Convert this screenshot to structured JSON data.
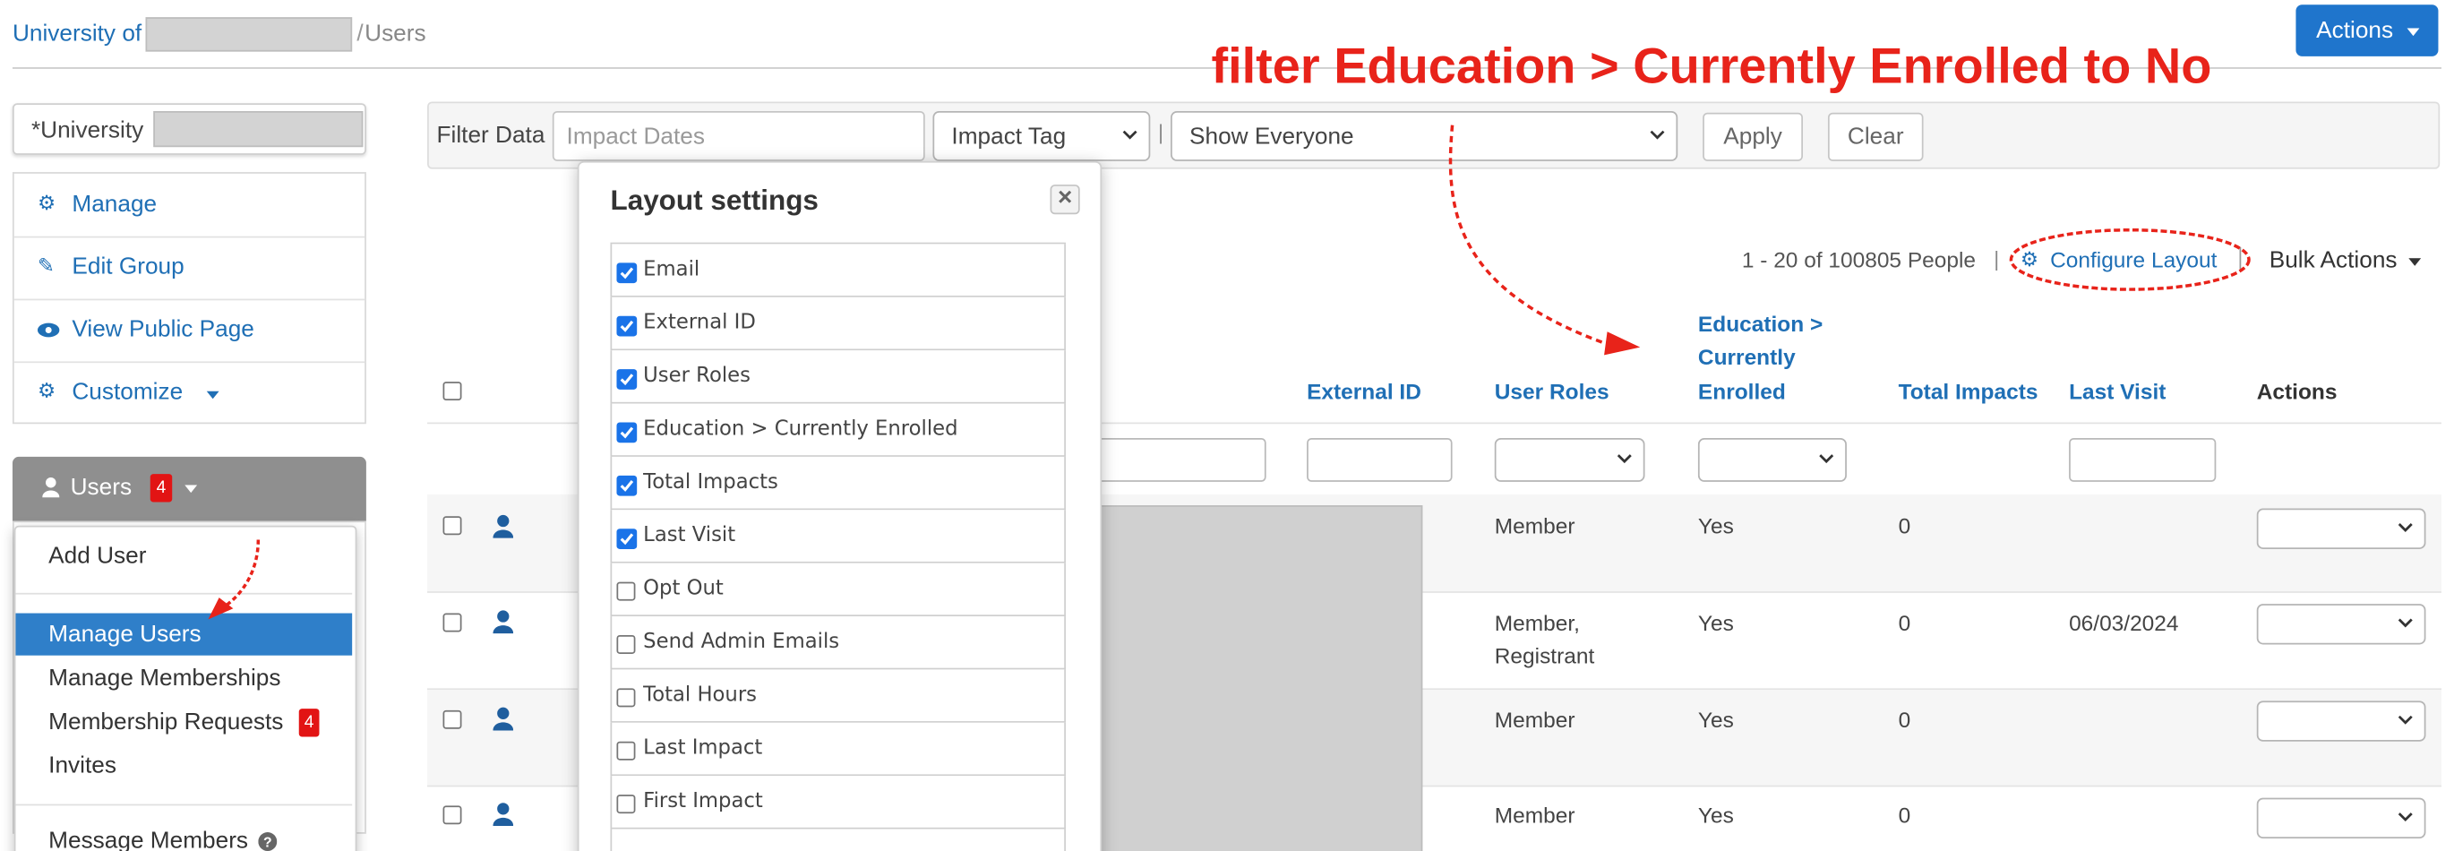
{
  "breadcrumb": {
    "root": "University of",
    "current": "Users",
    "separator": "/"
  },
  "header": {
    "actions_label": "Actions"
  },
  "annotation": {
    "text": "filter Education > Currently Enrolled to No"
  },
  "sidebar": {
    "group_name": "*University",
    "links": [
      {
        "label": "Manage",
        "icon": "gears-icon"
      },
      {
        "label": "Edit Group",
        "icon": "pencil-icon"
      },
      {
        "label": "View Public Page",
        "icon": "eye-icon"
      },
      {
        "label": "Customize",
        "icon": "gears-icon"
      }
    ],
    "users_button": {
      "label": "Users",
      "badge": "4"
    }
  },
  "users_menu": {
    "items": [
      "Add User",
      "Manage Users",
      "Manage Memberships",
      "Membership Requests",
      "Invites",
      "Message Members"
    ],
    "selected": "Manage Users",
    "requests_badge": "4"
  },
  "filter_bar": {
    "label": "Filter Data",
    "dates_placeholder": "Impact Dates",
    "impact_tag": "Impact Tag",
    "audience": "Show Everyone",
    "apply_label": "Apply",
    "clear_label": "Clear",
    "divider": "|"
  },
  "pagination": {
    "summary": "1 - 20 of 100805 People",
    "divider": "|"
  },
  "toolbar": {
    "configure_layout": "Configure Layout",
    "bulk_actions": "Bulk Actions"
  },
  "table": {
    "headers": {
      "external_id": "External ID",
      "user_roles": "User Roles",
      "enrolled_1": "Education >",
      "enrolled_2": "Currently",
      "enrolled_3": "Enrolled",
      "total_impacts": "Total Impacts",
      "last_visit": "Last Visit",
      "actions": "Actions"
    },
    "rows": [
      {
        "roles_1": "Member",
        "roles_2": "",
        "enrolled": "Yes",
        "impacts": "0",
        "last_visit": ""
      },
      {
        "roles_1": "Member,",
        "roles_2": "Registrant",
        "enrolled": "Yes",
        "impacts": "0",
        "last_visit": "06/03/2024"
      },
      {
        "roles_1": "Member",
        "roles_2": "",
        "enrolled": "Yes",
        "impacts": "0",
        "last_visit": ""
      },
      {
        "roles_1": "Member",
        "roles_2": "",
        "enrolled": "Yes",
        "impacts": "0",
        "last_visit": ""
      }
    ]
  },
  "layout_settings": {
    "title": "Layout settings",
    "close": "×",
    "options": [
      {
        "label": "Email",
        "checked": true
      },
      {
        "label": "External ID",
        "checked": true
      },
      {
        "label": "User Roles",
        "checked": true
      },
      {
        "label": "Education > Currently Enrolled",
        "checked": true
      },
      {
        "label": "Total Impacts",
        "checked": true
      },
      {
        "label": "Last Visit",
        "checked": true
      },
      {
        "label": "Opt Out",
        "checked": false
      },
      {
        "label": "Send Admin Emails",
        "checked": false
      },
      {
        "label": "Total Hours",
        "checked": false
      },
      {
        "label": "Last Impact",
        "checked": false
      },
      {
        "label": "First Impact",
        "checked": false
      }
    ]
  },
  "colors": {
    "link": "#1f6fb5",
    "accent": "#1a73e8",
    "annotation": "#e8231a",
    "menu_selected": "#2f7fc9",
    "badge": "#e21414"
  }
}
